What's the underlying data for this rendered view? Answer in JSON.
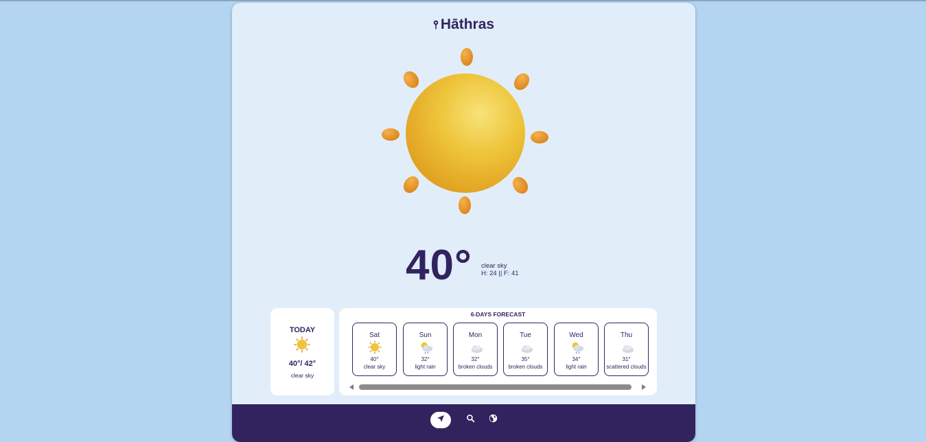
{
  "location": {
    "city": "Hāthras"
  },
  "current": {
    "temp": "40°",
    "description": "clear sky",
    "high_feels": "H: 24 || F: 41"
  },
  "today": {
    "title": "TODAY",
    "temps": "40°/ 42°",
    "description": "clear sky",
    "icon": "sun-icon"
  },
  "forecast": {
    "title": "6-DAYS FORECAST",
    "days": [
      {
        "name": "Sat",
        "temp": "40°",
        "description": "clear sky",
        "icon": "sun-icon"
      },
      {
        "name": "Sun",
        "temp": "32°",
        "description": "light rain",
        "icon": "sun-rain-cloud-icon"
      },
      {
        "name": "Mon",
        "temp": "32°",
        "description": "broken clouds",
        "icon": "cloud-icon"
      },
      {
        "name": "Tue",
        "temp": "35°",
        "description": "broken clouds",
        "icon": "cloud-icon"
      },
      {
        "name": "Wed",
        "temp": "34°",
        "description": "light rain",
        "icon": "sun-rain-cloud-icon"
      },
      {
        "name": "Thu",
        "temp": "31°",
        "description": "scattered clouds",
        "icon": "cloud-icon"
      }
    ]
  },
  "nav": {
    "items": [
      {
        "icon": "location-arrow-icon",
        "active": true
      },
      {
        "icon": "search-icon",
        "active": false
      },
      {
        "icon": "globe-icon",
        "active": false
      }
    ]
  },
  "colors": {
    "background": "#b3d5f2",
    "card": "#e1eef9",
    "accent": "#32235f",
    "sun": "#efc233",
    "ray": "#e6952a"
  }
}
